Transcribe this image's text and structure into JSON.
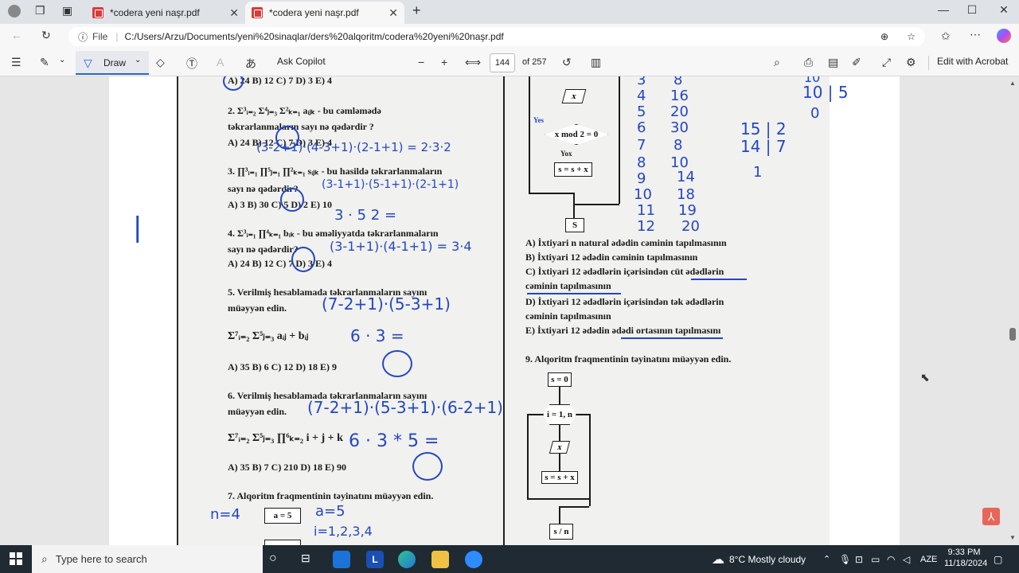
{
  "browser": {
    "tabs": [
      {
        "label": "*codera yeni naşr.pdf",
        "active": false
      },
      {
        "label": "*codera yeni naşr.pdf",
        "active": true
      }
    ],
    "new_tab": "+",
    "address": {
      "file_label": "File",
      "url": "C:/Users/Arzu/Documents/yeni%20sinaqlar/ders%20alqoritm/codera%20yeni%20naşr.pdf"
    }
  },
  "pdf_toolbar": {
    "draw_label": "Draw",
    "ask_copilot": "Ask Copilot",
    "page_number": "144",
    "page_total": "of 257",
    "edit_with_acrobat": "Edit with Acrobat"
  },
  "pdf_page": {
    "left_column": [
      {
        "text": "A) 24     B) 12     C) 7     D) 3     E) 4"
      },
      {
        "text": "2. Σ³ᵢ₌₂ Σ⁴ⱼ₌₃ Σ²ₖ₌₁ aᵢⱼₖ  - bu cəmləmədə"
      },
      {
        "text": "təkrarlanmaların sayı nə qədərdir ?"
      },
      {
        "text": "A) 24     B) 12     C) 7     D) 3     E) 4"
      },
      {
        "text": "3. ∏³ᵢ₌₁ ∏⁵ⱼ₌₁ ∏²ₖ₌₁ sᵢⱼₖ  - bu hasildə təkrarlanmaların"
      },
      {
        "text": "sayı nə qədərdir?"
      },
      {
        "text": "A) 3     B) 30     C) 5     D) 2     E) 10"
      },
      {
        "text": "4. Σ³ᵢ₌₁ ∏⁴ₖ₌₁ bᵢₖ  - bu əməliyyatda təkrarlanmaların"
      },
      {
        "text": "sayı nə qədərdir?"
      },
      {
        "text": "A) 24     B) 12     C) 7     D) 3     E) 4"
      },
      {
        "text": "5. Verilmiş hesablamada təkrarlanmaların sayını"
      },
      {
        "text": "müəyyən edin."
      },
      {
        "text": "A) 35     B) 6     C) 12     D) 18     E) 9"
      },
      {
        "text": "6. Verilmiş hesablamada təkrarlanmaların sayını"
      },
      {
        "text": "müəyyən edin."
      },
      {
        "text": "A) 35     B) 7     C) 210     D) 18     E) 90"
      },
      {
        "text": "7. Alqoritm fraqmentinin təyinatını müəyyən edin."
      }
    ],
    "formula5": "Σ⁷ᵢ₌₂ Σ⁵ⱼ₌₃ aᵢⱼ + bᵢⱼ",
    "formula6": "Σ⁷ᵢ₌₂ Σ⁵ⱼ₌₃ ∏⁶ₖ₌₂ i + j + k",
    "right_column": {
      "options": [
        "A) İxtiyari n natural ədədin cəminin tapılmasının",
        "B) İxtiyari 12 ədədin cəminin tapılmasının",
        "C) İxtiyari 12 ədədlərin içərisindən cüt ədədlərin",
        "cəminin tapılmasının",
        "D) İxtiyari 12 ədədlərin içərisindən tək ədədlərin",
        "cəminin tapılmasının",
        "E) İxtiyari 12 ədədin ədədi ortasının tapılmasını"
      ],
      "q9": "9. Alqoritm fraqmentinin təyinatını müəyyən edin.",
      "flow_top": {
        "cond": "x mod 2 = 0",
        "yes": "Yes",
        "no": "Yox",
        "assign": "s = s + x",
        "input": "x",
        "output": "S"
      },
      "flow9": {
        "init": "s = 0",
        "loop": "i = 1, n",
        "input": "x",
        "assign": "s = s + x",
        "output": "s / n"
      }
    },
    "q7_block": {
      "box": "a = 5"
    },
    "handwriting": {
      "q2": "(3-2+1)·(4-3+1)·(2-1+1) = 2·3·2",
      "q3": "(3-1+1)·(5-1+1)·(2-1+1)",
      "q3b": "3 · 5  2 =",
      "q4": "(3-1+1)·(4-1+1) = 3·4",
      "q5": "(7-2+1)·(5-3+1)",
      "q5b": "6 · 3 =",
      "q6": "(7-2+1)·(5-3+1)·(6-2+1)",
      "q6b": "6 · 3 * 5 =",
      "q7a": "n=4",
      "q7b": "a=5",
      "q7c": "i=1,2,3,4",
      "table_left": [
        "3",
        "4",
        "5",
        "6",
        "7",
        "8",
        "9",
        "10",
        "11",
        "12"
      ],
      "table_right": [
        "8",
        "16",
        "20",
        "30",
        "8",
        "10",
        "14",
        "18",
        "19",
        "20"
      ],
      "div1": "10 | 5",
      "div1b": "10",
      "div1c": "0",
      "div2a": "15 | 2",
      "div2b": "14 | 7",
      "div2c": "1",
      "margin_mark": "|"
    }
  },
  "taskbar": {
    "search_placeholder": "Type here to search",
    "weather": "8°C  Mostly cloudy",
    "lang": "AZE",
    "time": "9:33 PM",
    "date": "11/18/2024"
  }
}
